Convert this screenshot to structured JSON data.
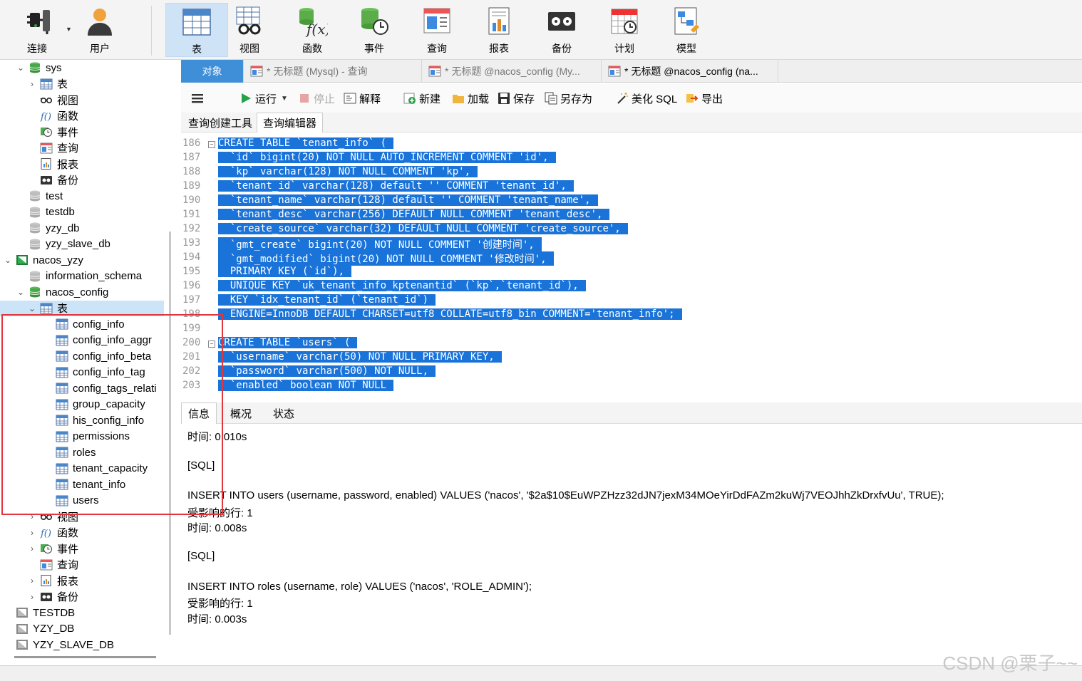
{
  "toolbar": [
    {
      "label": "连接",
      "icon": "plug-icon"
    },
    {
      "label": "用户",
      "icon": "user-icon"
    },
    {
      "label": "表",
      "icon": "table-icon",
      "active": true
    },
    {
      "label": "视图",
      "icon": "view-glasses-icon"
    },
    {
      "label": "函数",
      "icon": "function-icon"
    },
    {
      "label": "事件",
      "icon": "event-clock-icon"
    },
    {
      "label": "查询",
      "icon": "query-icon"
    },
    {
      "label": "报表",
      "icon": "report-icon"
    },
    {
      "label": "备份",
      "icon": "backup-icon"
    },
    {
      "label": "计划",
      "icon": "calendar-icon"
    },
    {
      "label": "模型",
      "icon": "model-icon"
    }
  ],
  "sidebar": [
    {
      "label": "sys",
      "icon": "database-icon",
      "tw": "v",
      "indent": 1
    },
    {
      "label": "表",
      "icon": "table-icon",
      "tw": ">",
      "indent": 2
    },
    {
      "label": "视图",
      "icon": "view-glasses-icon",
      "tw": "",
      "indent": 2
    },
    {
      "label": "函数",
      "icon": "function-icon",
      "tw": "",
      "indent": 2
    },
    {
      "label": "事件",
      "icon": "event-clock-icon",
      "tw": "",
      "indent": 2
    },
    {
      "label": "查询",
      "icon": "query-icon",
      "tw": "",
      "indent": 2
    },
    {
      "label": "报表",
      "icon": "report-icon",
      "tw": "",
      "indent": 2
    },
    {
      "label": "备份",
      "icon": "backup-icon",
      "tw": "",
      "indent": 2
    },
    {
      "label": "test",
      "icon": "database-gray-icon",
      "tw": "",
      "indent": 1
    },
    {
      "label": "testdb",
      "icon": "database-gray-icon",
      "tw": "",
      "indent": 1
    },
    {
      "label": "yzy_db",
      "icon": "database-gray-icon",
      "tw": "",
      "indent": 1
    },
    {
      "label": "yzy_slave_db",
      "icon": "database-gray-icon",
      "tw": "",
      "indent": 1
    },
    {
      "label": "nacos_yzy",
      "icon": "connection-icon",
      "tw": "v",
      "indent": 0
    },
    {
      "label": "information_schema",
      "icon": "database-gray-icon",
      "tw": "",
      "indent": 1
    },
    {
      "label": "nacos_config",
      "icon": "database-icon",
      "tw": "v",
      "indent": 1
    },
    {
      "label": "表",
      "icon": "table-icon",
      "tw": "v",
      "indent": 2,
      "selected": true
    },
    {
      "label": "config_info",
      "icon": "table-icon",
      "tw": "",
      "indent": 3
    },
    {
      "label": "config_info_aggr",
      "icon": "table-icon",
      "tw": "",
      "indent": 3
    },
    {
      "label": "config_info_beta",
      "icon": "table-icon",
      "tw": "",
      "indent": 3
    },
    {
      "label": "config_info_tag",
      "icon": "table-icon",
      "tw": "",
      "indent": 3
    },
    {
      "label": "config_tags_relati",
      "icon": "table-icon",
      "tw": "",
      "indent": 3
    },
    {
      "label": "group_capacity",
      "icon": "table-icon",
      "tw": "",
      "indent": 3
    },
    {
      "label": "his_config_info",
      "icon": "table-icon",
      "tw": "",
      "indent": 3
    },
    {
      "label": "permissions",
      "icon": "table-icon",
      "tw": "",
      "indent": 3
    },
    {
      "label": "roles",
      "icon": "table-icon",
      "tw": "",
      "indent": 3
    },
    {
      "label": "tenant_capacity",
      "icon": "table-icon",
      "tw": "",
      "indent": 3
    },
    {
      "label": "tenant_info",
      "icon": "table-icon",
      "tw": "",
      "indent": 3
    },
    {
      "label": "users",
      "icon": "table-icon",
      "tw": "",
      "indent": 3
    },
    {
      "label": "视图",
      "icon": "view-glasses-icon",
      "tw": ">",
      "indent": 2
    },
    {
      "label": "函数",
      "icon": "function-icon",
      "tw": ">",
      "indent": 2
    },
    {
      "label": "事件",
      "icon": "event-clock-icon",
      "tw": ">",
      "indent": 2
    },
    {
      "label": "查询",
      "icon": "query-icon",
      "tw": "",
      "indent": 2
    },
    {
      "label": "报表",
      "icon": "report-icon",
      "tw": ">",
      "indent": 2
    },
    {
      "label": "备份",
      "icon": "backup-icon",
      "tw": ">",
      "indent": 2
    },
    {
      "label": "TESTDB",
      "icon": "connection-gray-icon",
      "tw": "",
      "indent": 0
    },
    {
      "label": "YZY_DB",
      "icon": "connection-gray-icon",
      "tw": "",
      "indent": 0
    },
    {
      "label": "YZY_SLAVE_DB",
      "icon": "connection-gray-icon",
      "tw": "",
      "indent": 0
    }
  ],
  "tabs": {
    "objects": "对象",
    "items": [
      {
        "label": "* 无标题 (Mysql) - 查询",
        "dim": true
      },
      {
        "label": "* 无标题 @nacos_config (My...",
        "dim": true
      },
      {
        "label": "* 无标题 @nacos_config (na...",
        "dim": false
      }
    ]
  },
  "qtoolbar": {
    "run": "运行",
    "stop": "停止",
    "explain": "解释",
    "new": "新建",
    "load": "加载",
    "save": "保存",
    "save_as": "另存为",
    "beautify": "美化 SQL",
    "export": "导出"
  },
  "subtabs": {
    "builder": "查询创建工具",
    "editor": "查询编辑器"
  },
  "code": [
    {
      "n": "186",
      "fold": true,
      "t": "CREATE TABLE `tenant_info` ("
    },
    {
      "n": "187",
      "t": "  `id` bigint(20) NOT NULL AUTO_INCREMENT COMMENT 'id',"
    },
    {
      "n": "188",
      "t": "  `kp` varchar(128) NOT NULL COMMENT 'kp',"
    },
    {
      "n": "189",
      "t": "  `tenant_id` varchar(128) default '' COMMENT 'tenant_id',"
    },
    {
      "n": "190",
      "t": "  `tenant_name` varchar(128) default '' COMMENT 'tenant_name',"
    },
    {
      "n": "191",
      "t": "  `tenant_desc` varchar(256) DEFAULT NULL COMMENT 'tenant_desc',"
    },
    {
      "n": "192",
      "t": "  `create_source` varchar(32) DEFAULT NULL COMMENT 'create_source',"
    },
    {
      "n": "193",
      "t": "  `gmt_create` bigint(20) NOT NULL COMMENT '创建时间',"
    },
    {
      "n": "194",
      "t": "  `gmt_modified` bigint(20) NOT NULL COMMENT '修改时间',"
    },
    {
      "n": "195",
      "t": "  PRIMARY KEY (`id`),"
    },
    {
      "n": "196",
      "t": "  UNIQUE KEY `uk_tenant_info_kptenantid` (`kp`,`tenant_id`),"
    },
    {
      "n": "197",
      "t": "  KEY `idx_tenant_id` (`tenant_id`)"
    },
    {
      "n": "198",
      "t": "  ENGINE=InnoDB DEFAULT CHARSET=utf8 COLLATE=utf8_bin COMMENT='tenant_info';"
    },
    {
      "n": "199",
      "t": ""
    },
    {
      "n": "200",
      "fold": true,
      "t": "CREATE TABLE `users` ("
    },
    {
      "n": "201",
      "t": "  `username` varchar(50) NOT NULL PRIMARY KEY,"
    },
    {
      "n": "202",
      "t": "  `password` varchar(500) NOT NULL,"
    },
    {
      "n": "203",
      "t": "  `enabled` boolean NOT NULL"
    }
  ],
  "infotabs": {
    "info": "信息",
    "profile": "概况",
    "status": "状态"
  },
  "info_lines": [
    "时间: 0.010s",
    "",
    "[SQL]",
    "",
    "INSERT INTO users (username, password, enabled) VALUES ('nacos', '$2a$10$EuWPZHzz32dJN7jexM34MOeYirDdFAZm2kuWj7VEOJhhZkDrxfvUu', TRUE);",
    "受影响的行: 1",
    "时间: 0.008s",
    "",
    "[SQL]",
    "",
    "INSERT INTO roles (username, role) VALUES ('nacos', 'ROLE_ADMIN');",
    "受影响的行: 1",
    "时间: 0.003s"
  ],
  "watermark": "CSDN @栗子~~",
  "colors": {
    "selection": "#1a73d9",
    "active_tab": "#3f8fd8",
    "highlight_box": "#e0373f"
  }
}
